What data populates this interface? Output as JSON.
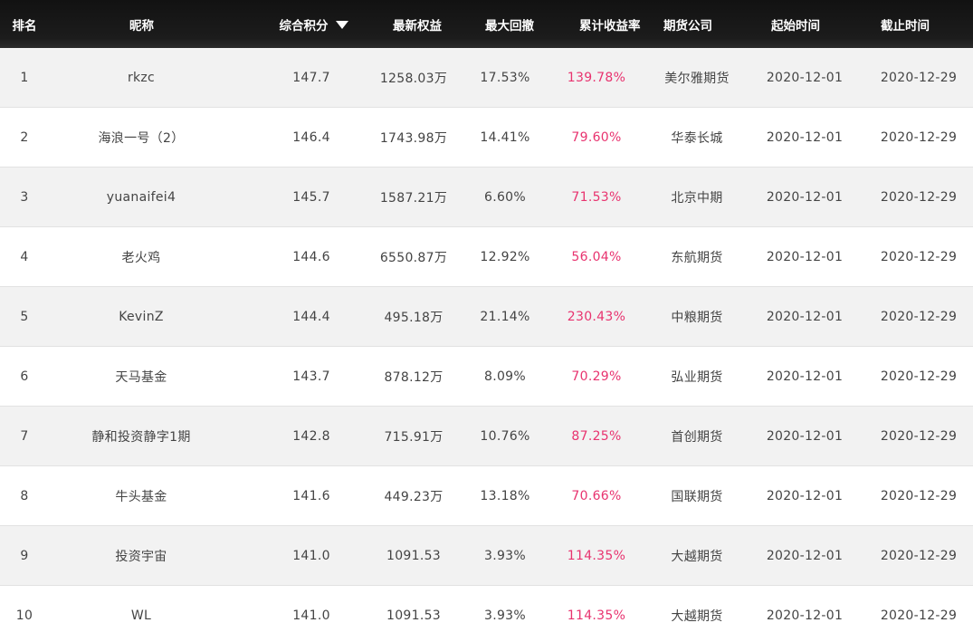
{
  "columns": {
    "rank": "排名",
    "nickname": "昵称",
    "score": "综合积分",
    "equity": "最新权益",
    "max_drawdown": "最大回撤",
    "cumulative_return": "累计收益率",
    "futures_company": "期货公司",
    "start_time": "起始时间",
    "end_time": "截止时间"
  },
  "sort": {
    "column": "score",
    "direction": "descending",
    "icon": "sort-down-triangle-icon"
  },
  "colors": {
    "header_bg": "#141414",
    "return_text": "#e8336f",
    "row_alt": "#f2f2f2"
  },
  "rows": [
    {
      "rank": "1",
      "nickname": "rkzc",
      "score": "147.7",
      "equity": "1258.03万",
      "max_drawdown": "17.53%",
      "cumulative_return": "139.78%",
      "futures_company": "美尔雅期货",
      "start_time": "2020-12-01",
      "end_time": "2020-12-29"
    },
    {
      "rank": "2",
      "nickname": "海浪一号（2）",
      "score": "146.4",
      "equity": "1743.98万",
      "max_drawdown": "14.41%",
      "cumulative_return": "79.60%",
      "futures_company": "华泰长城",
      "start_time": "2020-12-01",
      "end_time": "2020-12-29"
    },
    {
      "rank": "3",
      "nickname": "yuanaifei4",
      "score": "145.7",
      "equity": "1587.21万",
      "max_drawdown": "6.60%",
      "cumulative_return": "71.53%",
      "futures_company": "北京中期",
      "start_time": "2020-12-01",
      "end_time": "2020-12-29"
    },
    {
      "rank": "4",
      "nickname": "老火鸡",
      "score": "144.6",
      "equity": "6550.87万",
      "max_drawdown": "12.92%",
      "cumulative_return": "56.04%",
      "futures_company": "东航期货",
      "start_time": "2020-12-01",
      "end_time": "2020-12-29"
    },
    {
      "rank": "5",
      "nickname": "KevinZ",
      "score": "144.4",
      "equity": "495.18万",
      "max_drawdown": "21.14%",
      "cumulative_return": "230.43%",
      "futures_company": "中粮期货",
      "start_time": "2020-12-01",
      "end_time": "2020-12-29"
    },
    {
      "rank": "6",
      "nickname": "天马基金",
      "score": "143.7",
      "equity": "878.12万",
      "max_drawdown": "8.09%",
      "cumulative_return": "70.29%",
      "futures_company": "弘业期货",
      "start_time": "2020-12-01",
      "end_time": "2020-12-29"
    },
    {
      "rank": "7",
      "nickname": "静和投资静字1期",
      "score": "142.8",
      "equity": "715.91万",
      "max_drawdown": "10.76%",
      "cumulative_return": "87.25%",
      "futures_company": "首创期货",
      "start_time": "2020-12-01",
      "end_time": "2020-12-29"
    },
    {
      "rank": "8",
      "nickname": "牛头基金",
      "score": "141.6",
      "equity": "449.23万",
      "max_drawdown": "13.18%",
      "cumulative_return": "70.66%",
      "futures_company": "国联期货",
      "start_time": "2020-12-01",
      "end_time": "2020-12-29"
    },
    {
      "rank": "9",
      "nickname": "投资宇宙",
      "score": "141.0",
      "equity": "1091.53",
      "max_drawdown": "3.93%",
      "cumulative_return": "114.35%",
      "futures_company": "大越期货",
      "start_time": "2020-12-01",
      "end_time": "2020-12-29"
    },
    {
      "rank": "10",
      "nickname": "WL",
      "score": "141.0",
      "equity": "1091.53",
      "max_drawdown": "3.93%",
      "cumulative_return": "114.35%",
      "futures_company": "大越期货",
      "start_time": "2020-12-01",
      "end_time": "2020-12-29"
    }
  ]
}
